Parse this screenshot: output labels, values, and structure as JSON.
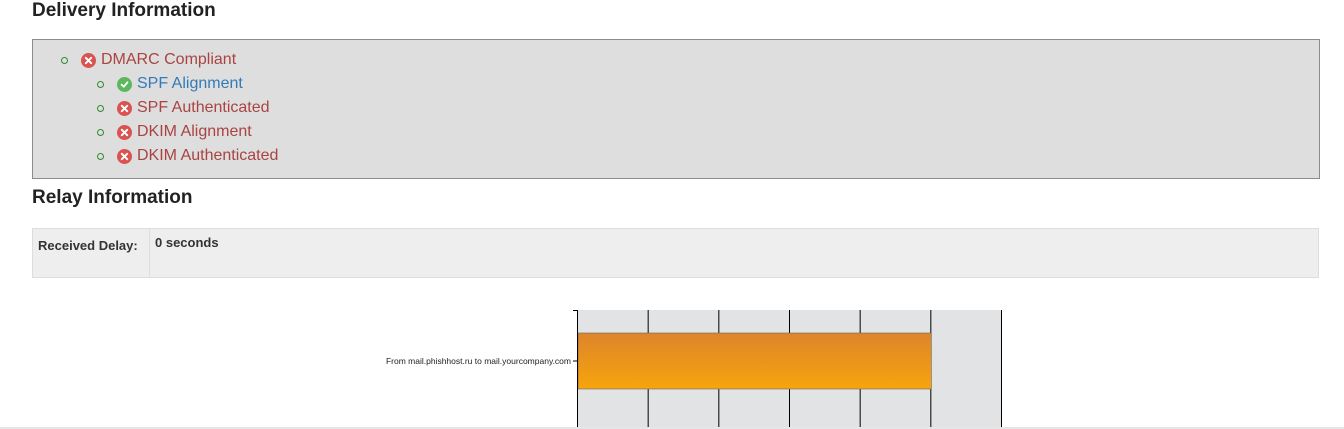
{
  "delivery": {
    "title": "Delivery Information",
    "checks": [
      {
        "label": "DMARC Compliant",
        "status": "fail"
      },
      {
        "label": "SPF Alignment",
        "status": "pass"
      },
      {
        "label": "SPF Authenticated",
        "status": "fail"
      },
      {
        "label": "DKIM Alignment",
        "status": "fail"
      },
      {
        "label": "DKIM Authenticated",
        "status": "fail"
      }
    ]
  },
  "relay": {
    "title": "Relay Information",
    "received_delay_label": "Received Delay:",
    "received_delay_value": "0 seconds"
  },
  "chart_data": {
    "type": "bar",
    "orientation": "horizontal",
    "categories": [
      "From mail.phishhost.ru to mail.yourcompany.com"
    ],
    "values": [
      5
    ],
    "xlim": [
      0,
      6
    ],
    "grid": true,
    "colors": {
      "bar_top": "#dd852c",
      "bar_bottom": "#f7a40b",
      "plot_bg": "#e2e3e5"
    }
  },
  "colors": {
    "fail": "#d9534f",
    "pass": "#5cb85c",
    "fail_text": "#a94442",
    "pass_text": "#337ab7"
  },
  "icons": {
    "fail": "times-circle-icon",
    "pass": "check-circle-icon"
  }
}
